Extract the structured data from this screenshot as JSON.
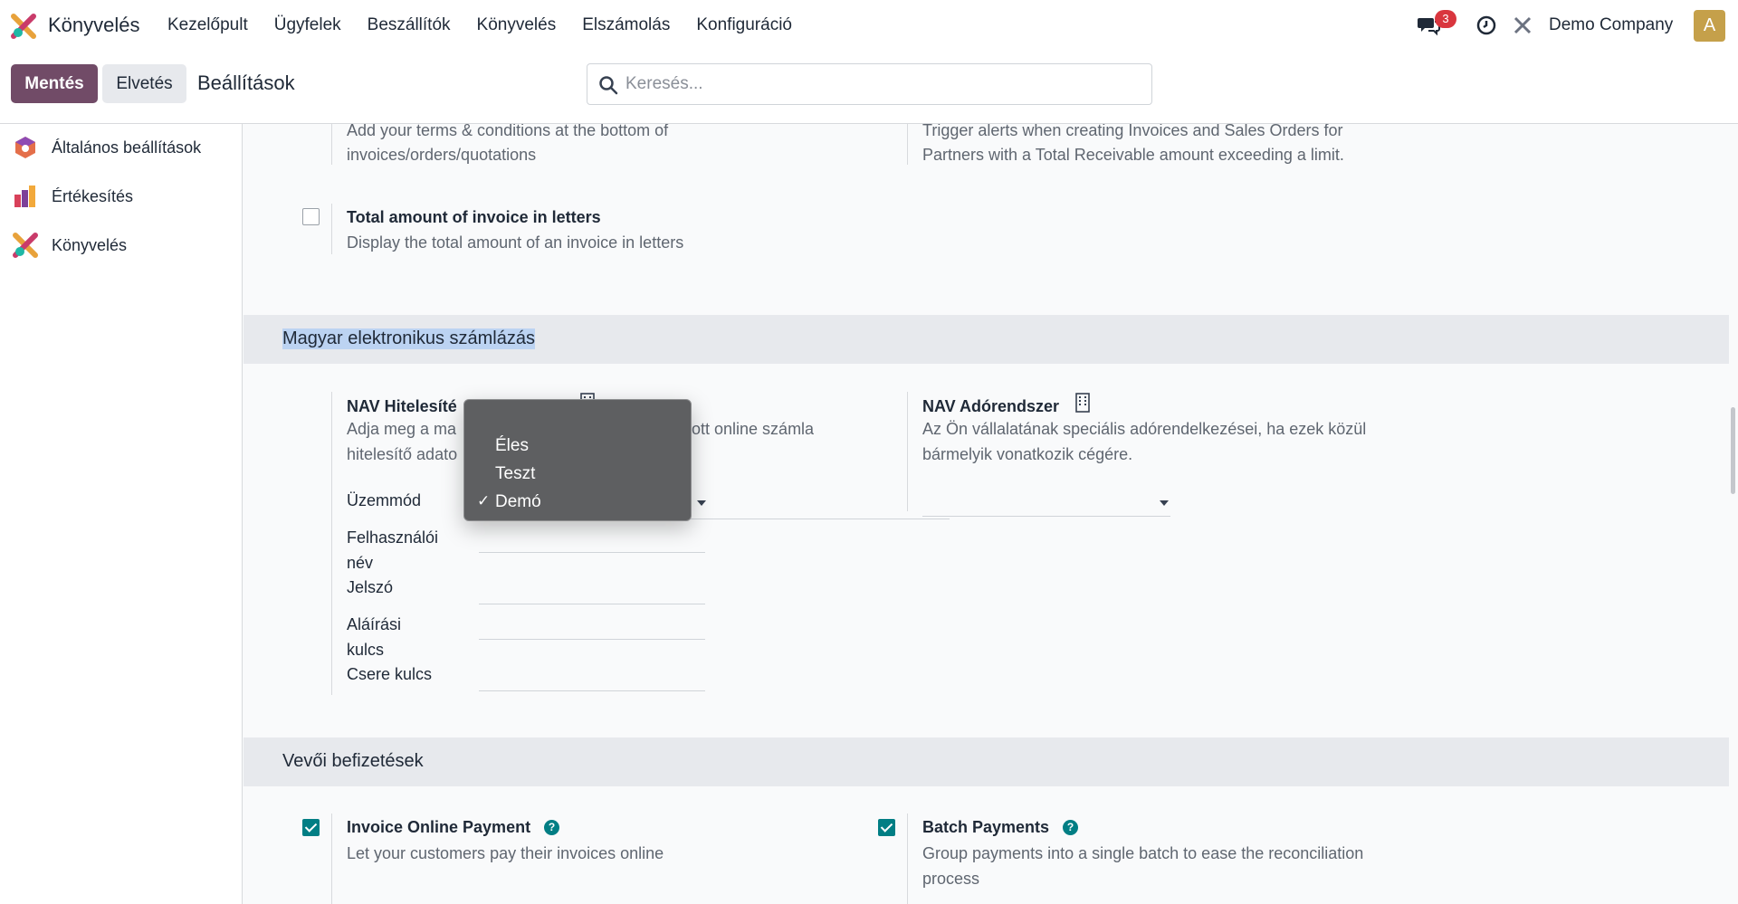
{
  "app": {
    "name": "Könyvelés"
  },
  "topnav": {
    "menu": [
      "Kezelőpult",
      "Ügyfelek",
      "Beszállítók",
      "Könyvelés",
      "Elszámolás",
      "Konfiguráció"
    ],
    "messages_count": "3",
    "company": "Demo Company",
    "avatar_letter": "A"
  },
  "control_panel": {
    "save_label": "Mentés",
    "discard_label": "Elvetés",
    "title": "Beállítások",
    "search_placeholder": "Keresés..."
  },
  "sidebar": {
    "items": [
      {
        "label": "Általános beállítások",
        "icon": "general-settings-icon"
      },
      {
        "label": "Értékesítés",
        "icon": "sales-icon"
      },
      {
        "label": "Könyvelés",
        "icon": "accounting-icon"
      }
    ]
  },
  "settings": {
    "terms": {
      "desc1": "Add your terms & conditions at the bottom of",
      "desc2": "invoices/orders/quotations"
    },
    "credit_limit": {
      "desc1": "Trigger alerts when creating Invoices and Sales Orders for",
      "desc2": "Partners with a Total Receivable amount exceeding a limit."
    },
    "amount_letters": {
      "title": "Total amount of invoice in letters",
      "desc": "Display the total amount of an invoice in letters",
      "checked": false
    },
    "hu_section": {
      "title": "Magyar elektronikus számlázás"
    },
    "nav_auth": {
      "title": "NAV Hitelesíté",
      "desc1_a": "Adja meg a ma",
      "desc1_b": "ott online számla",
      "desc2": "hitelesítő adato",
      "mode_label": "Üzemmód",
      "user_label": "Felhasználói név",
      "password_label": "Jelszó",
      "sign_key_label": "Aláírási kulcs",
      "exchange_key_label": "Csere kulcs"
    },
    "nav_tax": {
      "title": "NAV Adórendszer",
      "desc1": "Az Ön vállalatának speciális adórendelkezései, ha ezek közül",
      "desc2": "bármelyik vonatkozik cégére."
    },
    "payments_section": {
      "title": "Vevői befizetések"
    },
    "online_payment": {
      "title": "Invoice Online Payment",
      "desc": "Let your customers pay their invoices online",
      "checked": true
    },
    "batch_payments": {
      "title": "Batch Payments",
      "desc1": "Group payments into a single batch to ease the reconciliation",
      "desc2": "process",
      "checked": true
    }
  },
  "mode_dropdown": {
    "options": [
      "Éles",
      "Teszt",
      "Demó"
    ],
    "selected": "Demó",
    "check_mark": "✓"
  },
  "colors": {
    "primary": "#714b67",
    "accent": "#017e84",
    "badge": "#d9363e"
  }
}
